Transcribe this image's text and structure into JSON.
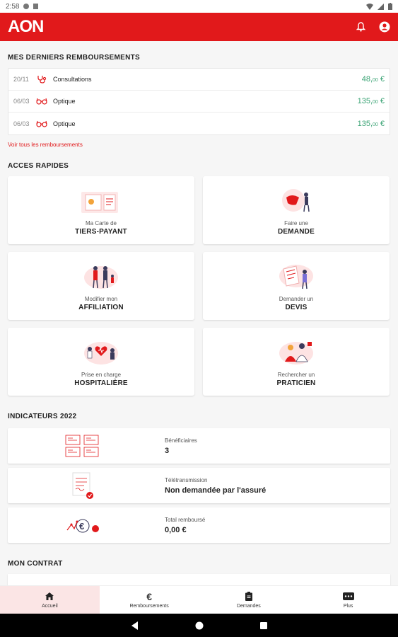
{
  "status_bar": {
    "time": "2:58"
  },
  "header": {
    "logo": "AON",
    "icons": [
      "bell-icon",
      "account-icon"
    ]
  },
  "reimbursements": {
    "title": "MES DERNIERS REMBOURSEMENTS",
    "rows": [
      {
        "date": "20/11",
        "icon": "stethoscope-icon",
        "label": "Consultations",
        "amount_main": "48,",
        "amount_cents": "00",
        "currency": " €"
      },
      {
        "date": "06/03",
        "icon": "glasses-icon",
        "label": "Optique",
        "amount_main": "135,",
        "amount_cents": "00",
        "currency": " €"
      },
      {
        "date": "06/03",
        "icon": "glasses-icon",
        "label": "Optique",
        "amount_main": "135,",
        "amount_cents": "00",
        "currency": " €"
      }
    ],
    "see_all": "Voir tous les remboursements"
  },
  "quick_access": {
    "title": "ACCES RAPIDES",
    "cards": [
      {
        "small": "Ma Carte de",
        "big": "TIERS-PAYANT",
        "name": "card-tiers-payant"
      },
      {
        "small": "Faire une",
        "big": "DEMANDE",
        "name": "card-demande"
      },
      {
        "small": "Modifier mon",
        "big": "AFFILIATION",
        "name": "card-affiliation"
      },
      {
        "small": "Demander un",
        "big": "DEVIS",
        "name": "card-devis"
      },
      {
        "small": "Prise en charge",
        "big": "HOSPITALIÈRE",
        "name": "card-hospitaliere"
      },
      {
        "small": "Rechercher un",
        "big": "PRATICIEN",
        "name": "card-praticien"
      }
    ]
  },
  "indicators": {
    "title": "INDICATEURS 2022",
    "items": [
      {
        "label": "Bénéficiaires",
        "value": "3"
      },
      {
        "label": "Télétransmission",
        "value": "Non demandée par l'assuré"
      },
      {
        "label": "Total remboursé",
        "value": "0,00 €"
      }
    ]
  },
  "contract": {
    "title": "MON CONTRAT"
  },
  "bottom_nav": [
    {
      "label": "Accueil",
      "icon": "home-icon",
      "active": true
    },
    {
      "label": "Remboursements",
      "icon": "euro-icon",
      "active": false
    },
    {
      "label": "Demandes",
      "icon": "clipboard-icon",
      "active": false
    },
    {
      "label": "Plus",
      "icon": "more-icon",
      "active": false
    }
  ],
  "colors": {
    "brand": "#e1191b",
    "amount": "#3aa374",
    "nav_active_bg": "#fbe5e5"
  }
}
